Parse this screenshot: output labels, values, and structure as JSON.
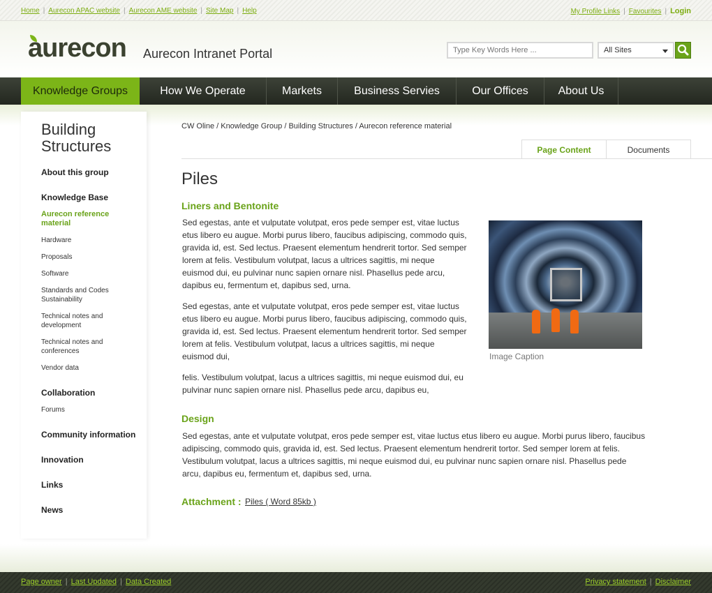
{
  "topbar": {
    "links": [
      "Home",
      "Aurecon APAC website",
      "Aurecon AME website",
      "Site Map",
      "Help"
    ],
    "right_links": [
      "My Profile Links",
      "Favourites"
    ],
    "login": "Login"
  },
  "header": {
    "logo": "aurecon",
    "portal_title": "Aurecon Intranet Portal",
    "search_placeholder": "Type Key Words Here ...",
    "site_select": "All Sites",
    "search_icon": "search-icon"
  },
  "nav": {
    "items": [
      "Knowledge Groups",
      "How We Operate",
      "Markets",
      "Business Servies",
      "Our Offices",
      "About Us"
    ],
    "active_index": 0
  },
  "sidebar": {
    "title": "Building Structures",
    "items": {
      "about": "About this group",
      "knowledge_base": "Knowledge Base",
      "kb_current": "Aurecon reference material",
      "kb_subs": [
        "Hardware",
        "Proposals",
        "Software",
        "Standards and Codes Sustainability",
        "Technical notes and development",
        "Technical notes and conferences",
        "Vendor data"
      ],
      "collaboration": "Collaboration",
      "forums": "Forums",
      "community": "Community information",
      "innovation": "Innovation",
      "links": "Links",
      "news": "News"
    }
  },
  "breadcrumb": "CW Oline / Knowledge Group / Building Structures / Aurecon reference material",
  "tabs": [
    "Page Content",
    "Documents"
  ],
  "content": {
    "title": "Piles",
    "section1": "Liners and Bentonite",
    "para1": "Sed egestas, ante et vulputate volutpat, eros pede semper est, vitae luctus etus libero eu augue. Morbi purus libero, faucibus adipiscing, commodo quis, gravida id, est. Sed lectus. Praesent elementum hendrerit tortor. Sed semper lorem at felis. Vestibulum volutpat, lacus a ultrices sagittis, mi neque euismod dui, eu pulvinar nunc sapien ornare nisl. Phasellus pede arcu, dapibus eu, fermentum et, dapibus sed, urna.",
    "para2": "Sed egestas, ante et vulputate volutpat, eros pede semper est, vitae luctus etus libero eu augue. Morbi purus libero, faucibus adipiscing, commodo quis, gravida id, est. Sed lectus. Praesent elementum hendrerit tortor. Sed semper lorem at felis. Vestibulum volutpat, lacus a ultrices sagittis, mi neque euismod dui,",
    "para3": "felis. Vestibulum volutpat, lacus a ultrices sagittis, mi neque euismod dui, eu pulvinar nunc sapien ornare nisl. Phasellus pede arcu, dapibus eu,",
    "image_caption": "Image Caption",
    "section2": "Design",
    "para4": "Sed egestas, ante et vulputate volutpat, eros pede semper est, vitae luctus etus libero eu augue. Morbi purus libero, faucibus adipiscing, commodo quis, gravida id, est. Sed lectus. Praesent elementum hendrerit tortor. Sed semper lorem at felis. Vestibulum volutpat, lacus a ultrices sagittis, mi neque euismod dui, eu pulvinar nunc sapien ornare nisl. Phasellus pede arcu, dapibus eu, fermentum et, dapibus sed, urna.",
    "attachment_label": "Attachment :",
    "attachment_link": "Piles ( Word 85kb )"
  },
  "footer": {
    "left_links": [
      "Page owner",
      "Last Updated",
      "Data Created"
    ],
    "right_links": [
      "Privacy statement",
      "Disclaimer"
    ]
  },
  "colors": {
    "accent_green": "#7cb518",
    "text_green": "#6aa31a",
    "nav_dark": "#2f342a"
  }
}
